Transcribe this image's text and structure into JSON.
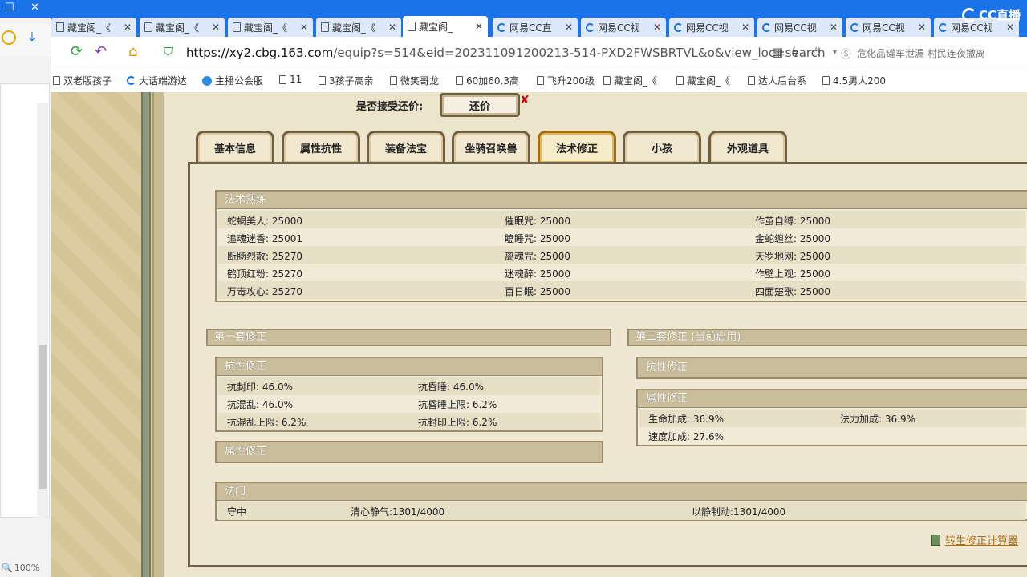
{
  "left_panel": {
    "zoom": "100%"
  },
  "tabs": [
    {
      "title": "藏宝阁_《",
      "icon": "doc-icon"
    },
    {
      "title": "藏宝阁_《",
      "icon": "doc-icon"
    },
    {
      "title": "藏宝阁_《",
      "icon": "doc-icon"
    },
    {
      "title": "藏宝阁_《",
      "icon": "doc-icon"
    },
    {
      "title": "藏宝阁_",
      "icon": "doc-icon",
      "active": true
    },
    {
      "title": "网易CC直",
      "icon": "cc-icon"
    },
    {
      "title": "网易CC视",
      "icon": "cc-icon"
    },
    {
      "title": "网易CC视",
      "icon": "cc-icon"
    },
    {
      "title": "网易CC视",
      "icon": "cc-icon"
    },
    {
      "title": "网易CC视",
      "icon": "cc-icon"
    },
    {
      "title": "网易CC视",
      "icon": "cc-icon"
    }
  ],
  "brand": {
    "logo_text": "CC直播"
  },
  "address": {
    "host": "https://xy2.cbg.163.com",
    "path": "/equip?s=514&eid=202311091200213-514-PXD2FWSBRTVL&o&view_loc=search",
    "news": "危化品罐车泄漏 村民连夜撤离"
  },
  "bookmarks": [
    {
      "label": "双老版孩子",
      "icon": "doc-icon"
    },
    {
      "label": "大话端游达",
      "icon": "cc-icon"
    },
    {
      "label": "主播公会服",
      "icon": "face-icon"
    },
    {
      "label": "11",
      "icon": "doc-icon"
    },
    {
      "label": "3孩子高亲",
      "icon": "doc-icon"
    },
    {
      "label": "微笑哥龙",
      "icon": "doc-icon"
    },
    {
      "label": "60加60.3高",
      "icon": "doc-icon"
    },
    {
      "label": "飞升200级",
      "icon": "doc-icon"
    },
    {
      "label": "藏宝阁_《",
      "icon": "doc-icon"
    },
    {
      "label": "藏宝阁_《",
      "icon": "doc-icon"
    },
    {
      "label": "达人后台系",
      "icon": "doc-icon"
    },
    {
      "label": "4.5男人200",
      "icon": "doc-icon"
    }
  ],
  "offer": {
    "label": "是否接受还价:",
    "button": "还价"
  },
  "game_tabs": [
    "基本信息",
    "属性抗性",
    "装备法宝",
    "坐骑召唤兽",
    "法术修正",
    "小孩",
    "外观道具"
  ],
  "skills": {
    "title": "法术熟练",
    "col1": [
      "蛇蝎美人: 25000",
      "追魂迷香: 25001",
      "断肠烈散: 25270",
      "鹤顶红粉: 25270",
      "万毒攻心: 25270"
    ],
    "col2": [
      "催眠咒: 25000",
      "瞌睡咒: 25000",
      "离魂咒: 25000",
      "迷魂醉: 25000",
      "百日眠: 25000"
    ],
    "col3": [
      "作茧自缚: 25000",
      "金蛇缠丝: 25000",
      "天罗地网: 25000",
      "作壁上观: 25000",
      "四面楚歌: 25000"
    ]
  },
  "set1": {
    "title": "第一套修正",
    "resist": {
      "title": "抗性修正",
      "left": [
        "抗封印: 46.0%",
        "抗混乱: 46.0%",
        "抗混乱上限: 6.2%"
      ],
      "right": [
        "抗昏睡: 46.0%",
        "抗昏睡上限: 6.2%",
        "抗封印上限: 6.2%"
      ]
    },
    "attr": {
      "title": "属性修正"
    }
  },
  "set2": {
    "title": "第二套修正 (当前启用)",
    "resist": {
      "title": "抗性修正"
    },
    "attr": {
      "title": "属性修正",
      "items": [
        "生命加成: 36.9%",
        "法力加成: 36.9%",
        "速度加成: 27.6%"
      ]
    }
  },
  "fame": {
    "title": "法门",
    "items": [
      "守中",
      "清心静气:1301/4000",
      "以静制动:1301/4000"
    ]
  },
  "calc_link": "转生修正计算器"
}
